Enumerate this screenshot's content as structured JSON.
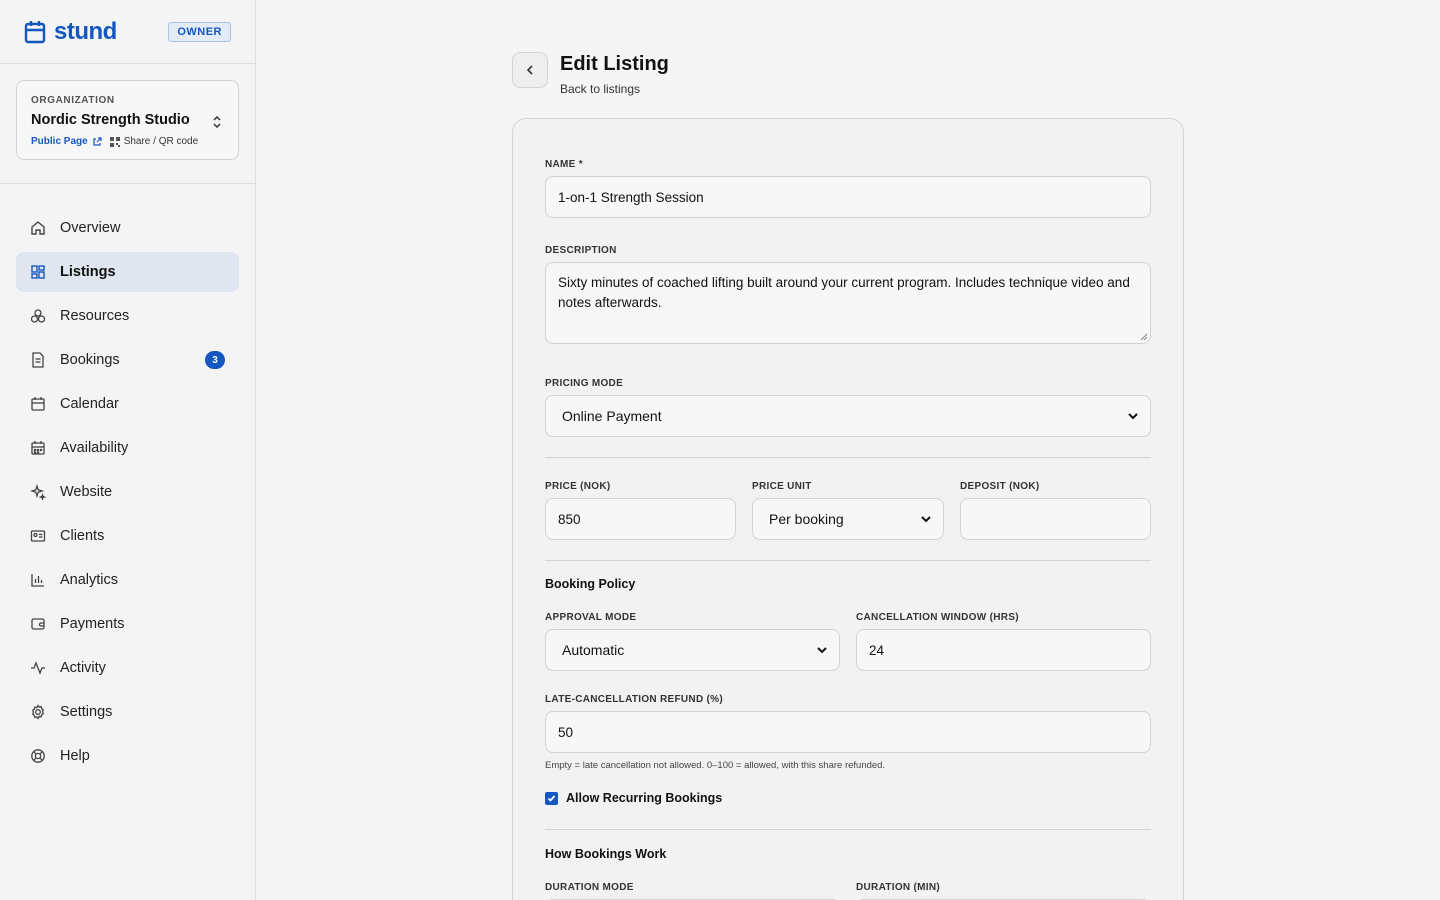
{
  "brand": {
    "name": "stund",
    "role": "OWNER"
  },
  "org": {
    "label": "ORGANIZATION",
    "name": "Nordic Strength Studio",
    "public_link": "Public Page",
    "share_link": "Share / QR code"
  },
  "nav": [
    {
      "label": "Overview",
      "icon": "home-icon"
    },
    {
      "label": "Listings",
      "icon": "grid-icon",
      "active": true
    },
    {
      "label": "Resources",
      "icon": "boxes-icon"
    },
    {
      "label": "Bookings",
      "icon": "document-icon",
      "badge": "3"
    },
    {
      "label": "Calendar",
      "icon": "calendar-icon"
    },
    {
      "label": "Availability",
      "icon": "calendar-grid-icon"
    },
    {
      "label": "Website",
      "icon": "sparkles-icon"
    },
    {
      "label": "Clients",
      "icon": "id-card-icon"
    },
    {
      "label": "Analytics",
      "icon": "bar-chart-icon"
    },
    {
      "label": "Payments",
      "icon": "wallet-icon"
    },
    {
      "label": "Activity",
      "icon": "activity-icon"
    },
    {
      "label": "Settings",
      "icon": "gear-icon"
    },
    {
      "label": "Help",
      "icon": "lifebuoy-icon"
    }
  ],
  "page": {
    "title": "Edit Listing",
    "subtitle": "Back to listings"
  },
  "form": {
    "name_label": "NAME *",
    "name_value": "1-on-1 Strength Session",
    "description_label": "DESCRIPTION",
    "description_value": "Sixty minutes of coached lifting built around your current program. Includes technique video and notes afterwards.",
    "pricing_mode_label": "PRICING MODE",
    "pricing_mode_value": "Online Payment",
    "price_label": "PRICE (NOK)",
    "price_value": "850",
    "price_unit_label": "PRICE UNIT",
    "price_unit_value": "Per booking",
    "deposit_label": "DEPOSIT (NOK)",
    "deposit_value": "",
    "booking_policy_title": "Booking Policy",
    "approval_mode_label": "APPROVAL MODE",
    "approval_mode_value": "Automatic",
    "cancellation_window_label": "CANCELLATION WINDOW (HRS)",
    "cancellation_window_value": "24",
    "late_refund_label": "LATE-CANCELLATION REFUND (%)",
    "late_refund_value": "50",
    "late_refund_hint": "Empty = late cancellation not allowed. 0–100 = allowed, with this share refunded.",
    "recurring_label": "Allow Recurring Bookings",
    "recurring_checked": true,
    "how_title": "How Bookings Work",
    "duration_mode_label": "DURATION MODE",
    "duration_label": "DURATION (MIN)"
  },
  "colors": {
    "accent": "#1557c0"
  }
}
